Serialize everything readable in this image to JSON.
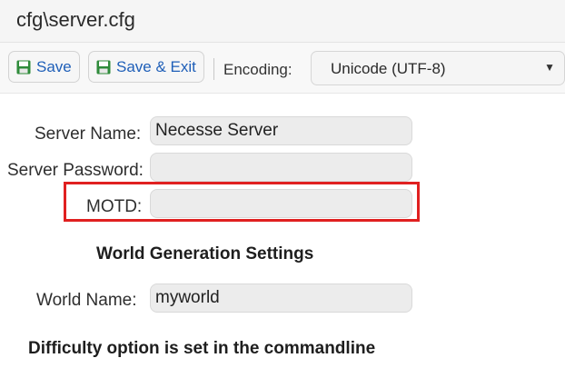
{
  "window": {
    "title": "cfg\\server.cfg"
  },
  "toolbar": {
    "save_label": "Save",
    "save_exit_label": "Save & Exit",
    "save_icon": "floppy-disk-icon",
    "encoding_label": "Encoding:",
    "encoding_value": "Unicode (UTF-8)"
  },
  "form": {
    "server_name": {
      "label": "Server Name:",
      "value": "Necesse Server"
    },
    "server_password": {
      "label": "Server Password:",
      "value": ""
    },
    "motd": {
      "label": "MOTD:",
      "value": ""
    },
    "world_generation_heading": "World Generation Settings",
    "world_name": {
      "label": "World Name:",
      "value": "myworld"
    },
    "difficulty_note": "Difficulty option is set in the commandline"
  },
  "colors": {
    "accent": "#1f5fb8",
    "highlight": "#e02020",
    "save_icon": "#2e8b3a"
  }
}
